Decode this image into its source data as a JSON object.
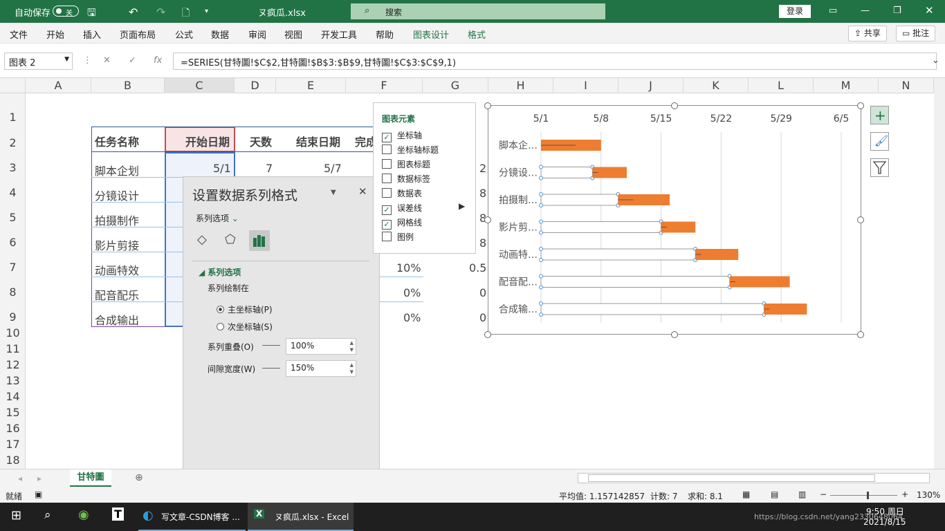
{
  "titlebar": {
    "autosave": "自动保存",
    "toggle": "关",
    "filename": "ヌ疯瓜.xlsx",
    "search": "搜索",
    "login": "登录"
  },
  "ribbon": {
    "tabs": [
      "文件",
      "开始",
      "插入",
      "页面布局",
      "公式",
      "数据",
      "审阅",
      "视图",
      "开发工具",
      "帮助",
      "图表设计",
      "格式"
    ],
    "share": "共享",
    "comment": "批注"
  },
  "formula_bar": {
    "name_box": "图表 2",
    "formula": "=SERIES(甘特圖!$C$2,甘特圖!$B$3:$B$9,甘特圖!$C$3:$C$9,1)",
    "fx": "fx"
  },
  "columns": [
    "A",
    "B",
    "C",
    "D",
    "E",
    "F",
    "G",
    "H",
    "I",
    "J",
    "K",
    "L",
    "M",
    "N"
  ],
  "rows": [
    "1",
    "2",
    "3",
    "4",
    "5",
    "6",
    "7",
    "8",
    "9",
    "10",
    "11",
    "12",
    "13",
    "14",
    "15",
    "16",
    "17",
    "18"
  ],
  "sheet": {
    "headers": {
      "b": "任务名称",
      "c": "开始日期",
      "d": "天数",
      "e": "结束日期",
      "f": "完成"
    },
    "tasks": [
      "脚本企划",
      "分镜设计",
      "拍摄制作",
      "影片剪接",
      "动画特效",
      "配音配乐",
      "合成输出"
    ],
    "row3": {
      "c": "5/1",
      "d": "7",
      "e": "5/7"
    },
    "f_values": [
      "10%",
      "0%",
      "0%"
    ],
    "g_values": [
      "2",
      "8",
      "8",
      "8",
      "0.5",
      "0",
      "0"
    ]
  },
  "panel": {
    "title": "设置数据系列格式",
    "options_label": "系列选项",
    "section": "系列选项",
    "plot_on": "系列绘制在",
    "primary": "主坐标轴(P)",
    "secondary": "次坐标轴(S)",
    "overlap_label": "系列重叠(O)",
    "overlap": "100%",
    "gap_label": "间隙宽度(W)",
    "gap": "150%"
  },
  "chart_elements": {
    "title": "图表元素",
    "items": [
      {
        "label": "坐标轴",
        "checked": true
      },
      {
        "label": "坐标轴标题",
        "checked": false
      },
      {
        "label": "图表标题",
        "checked": false
      },
      {
        "label": "数据标签",
        "checked": false
      },
      {
        "label": "数据表",
        "checked": false
      },
      {
        "label": "误差线",
        "checked": true
      },
      {
        "label": "网格线",
        "checked": true
      },
      {
        "label": "图例",
        "checked": false
      }
    ]
  },
  "chart_data": {
    "type": "bar",
    "orientation": "horizontal-stacked",
    "x_ticks": [
      "5/1",
      "5/8",
      "5/15",
      "5/22",
      "5/29",
      "6/5"
    ],
    "categories": [
      "脚本企…",
      "分镜设…",
      "拍摄制…",
      "影片剪…",
      "动画特…",
      "配音配…",
      "合成输…"
    ],
    "series": [
      {
        "values": [
          "5/1",
          "5/7",
          "5/10",
          "5/15",
          "5/19",
          "5/23",
          "5/27"
        ],
        "color": "#ffffff"
      },
      {
        "values": [
          7,
          4,
          6,
          4,
          5,
          7,
          5
        ],
        "color": "#ed7d31"
      }
    ],
    "grid": true
  },
  "sheet_tab": "甘特圖",
  "status": {
    "ready": "就绪",
    "average": "平均值: 1.157142857",
    "count": "计数: 7",
    "sum": "求和: 8.1",
    "zoom": "130%"
  },
  "taskbar": {
    "edge_label": "写文章-CSDN博客 ...",
    "excel_label": "ヌ疯瓜.xlsx - Excel",
    "time": "9:50 周日",
    "date": "2021/8/15",
    "watermark": "https://blog.csdn.net/yang2330648064"
  }
}
